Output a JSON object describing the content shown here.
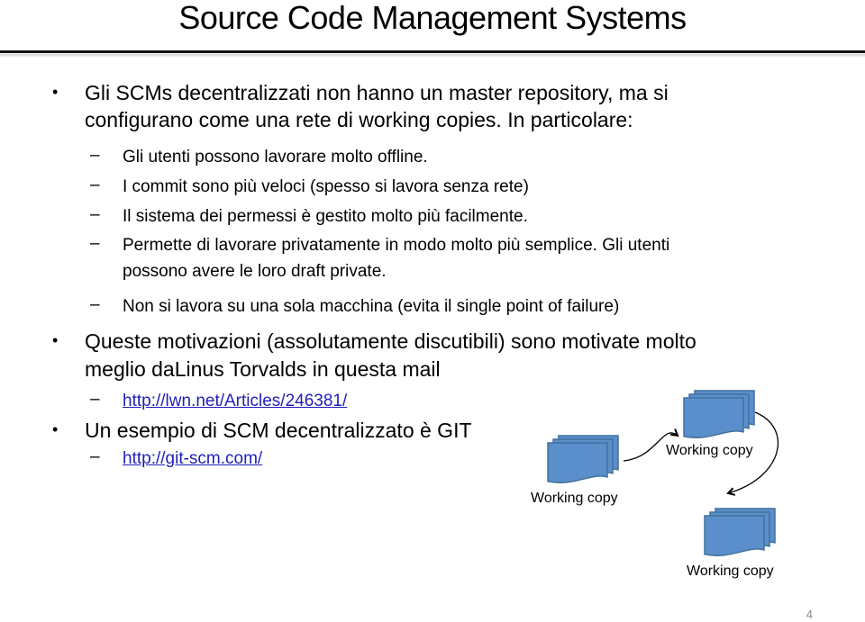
{
  "slide": {
    "title": "Source Code Management Systems",
    "page_number": "4"
  },
  "bullets": [
    {
      "lines": [
        "Gli SCMs decentralizzati non hanno un master repository, ma si",
        "configurano come una rete di working copies. In particolare:"
      ],
      "sub": [
        {
          "lines": [
            "Gli utenti possono lavorare molto offline."
          ]
        },
        {
          "lines": [
            "I commit sono più veloci (spesso si lavora senza rete)"
          ]
        },
        {
          "lines": [
            "Il sistema dei permessi è gestito molto più facilmente."
          ]
        },
        {
          "lines": [
            "Permette di lavorare privatamente in modo molto più semplice. Gli utenti",
            "possono avere le loro draft private."
          ]
        },
        {
          "lines": [
            "Non si lavora su una sola macchina (evita il single point of failure)"
          ]
        }
      ]
    },
    {
      "lines": [
        "Queste motivazioni (assolutamente discutibili) sono motivate molto",
        "meglio daLinus Torvalds in questa mail"
      ],
      "sub": [
        {
          "link": "http://lwn.net/Articles/246381/"
        }
      ]
    },
    {
      "lines": [
        "Un esempio di SCM decentralizzato è GIT"
      ],
      "sub": [
        {
          "link": "http://git-scm.com/"
        }
      ]
    }
  ],
  "diagram": {
    "nodes": [
      {
        "label": "Working copy"
      },
      {
        "label": "Working copy"
      },
      {
        "label": "Working copy"
      }
    ],
    "colors": {
      "doc_fill": "#5b8fcb",
      "doc_stroke": "#41719c",
      "arrow": "#000000"
    }
  },
  "glyphs": {
    "bullet": "•",
    "dash": "–"
  }
}
